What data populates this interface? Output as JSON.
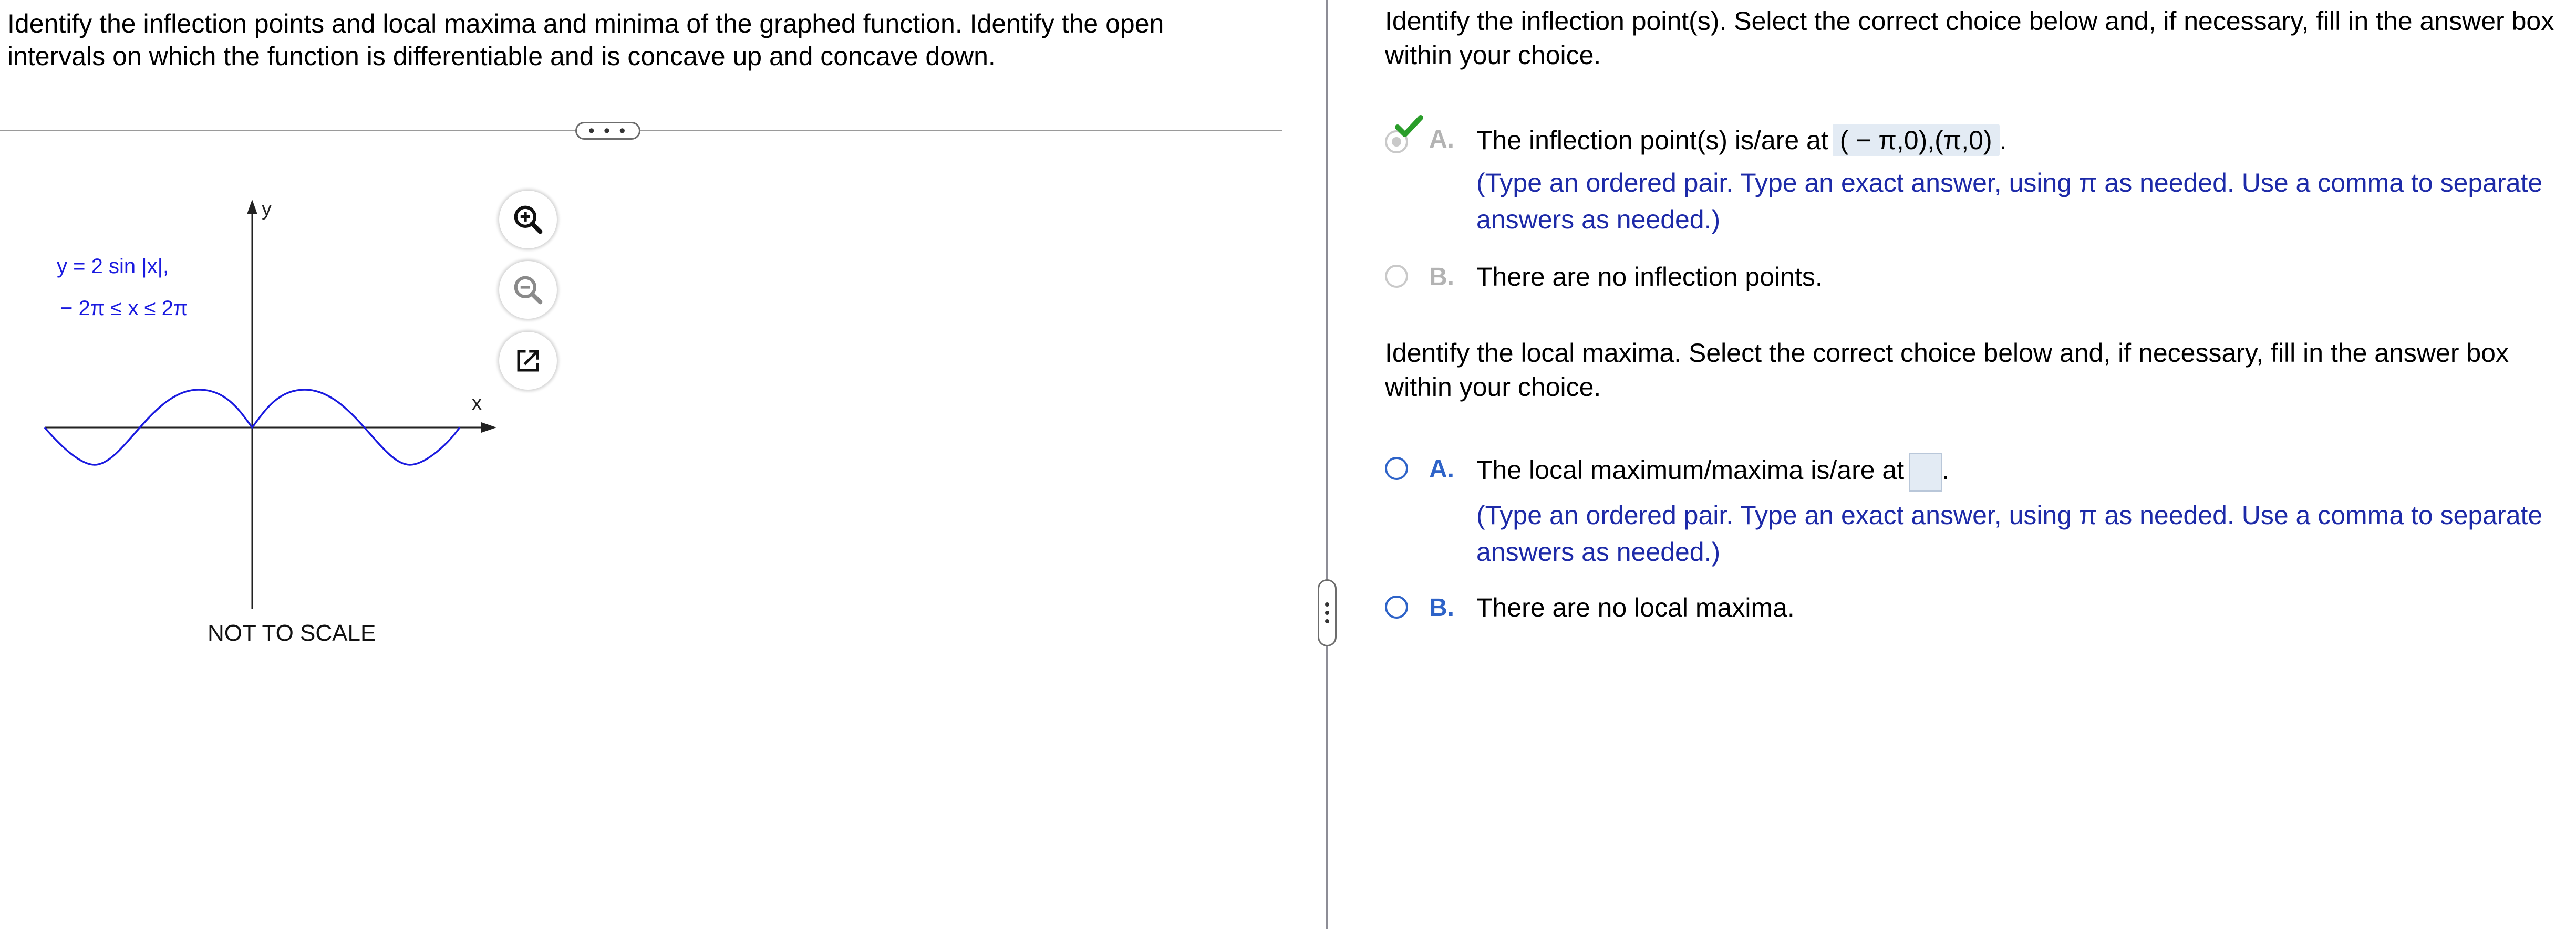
{
  "left_panel": {
    "prompt": "Identify the inflection points and local maxima and minima of the graphed function. Identify the open intervals on which the function is differentiable and is concave up and concave down.",
    "more_button_label": "• • •",
    "graph": {
      "equation": "y = 2 sin |x|,",
      "domain": "− 2π ≤ x ≤ 2π",
      "x_axis_label": "x",
      "y_axis_label": "y",
      "note": "NOT TO SCALE",
      "curve_color": "#1a1adf"
    },
    "tools": {
      "zoom_in_icon": "zoom-in-icon",
      "zoom_out_icon": "zoom-out-icon",
      "popout_icon": "popout-icon"
    }
  },
  "right_panel": {
    "q1": {
      "prompt": "Identify the inflection point(s). Select the correct choice below and, if necessary, fill in the answer box within your choice.",
      "choice_a_letter": "A.",
      "choice_a_text": "The inflection point(s) is/are at",
      "choice_a_answer": "( − π,0),(π,0)",
      "choice_a_hint": "(Type an ordered pair. Type an exact answer, using π as needed. Use a comma to separate answers as needed.)",
      "choice_b_letter": "B.",
      "choice_b_text": "There are no inflection points.",
      "status": "correct"
    },
    "q2": {
      "prompt": "Identify the local maxima. Select the correct choice below and, if necessary, fill in the answer box within your choice.",
      "choice_a_letter": "A.",
      "choice_a_text": "The local maximum/maxima is/are at",
      "choice_a_answer": "",
      "choice_a_hint": "(Type an ordered pair. Type an exact answer, using π as needed. Use a comma to separate answers as needed.)",
      "choice_b_letter": "B.",
      "choice_b_text": "There are no local maxima."
    }
  },
  "colors": {
    "accent": "#2e63c8",
    "hint": "#1d2aa8",
    "check": "#2a9d2a"
  }
}
